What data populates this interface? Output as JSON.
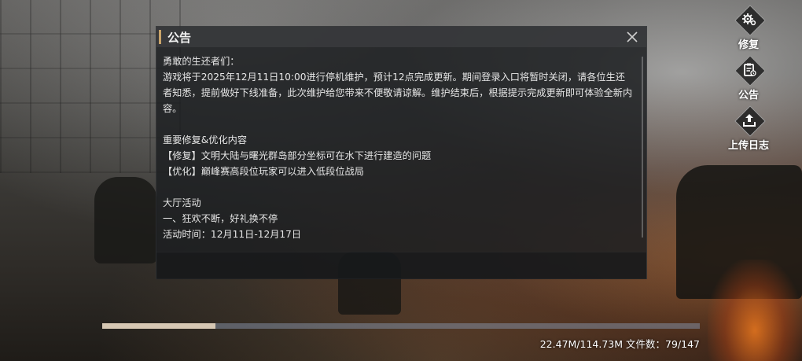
{
  "announcement": {
    "title": "公告",
    "paragraphs": [
      "勇敢的生还者们：",
      "游戏将于2025年12月11日10:00进行停机维护，预计12点完成更新。期间登录入口将暂时关闭，请各位生还者知悉，提前做好下线准备，此次维护给您带来不便敬请谅解。维护结束后，根据提示完成更新即可体验全新内容。",
      "",
      "重要修复&优化内容",
      "【修复】文明大陆与曙光群岛部分坐标可在水下进行建造的问题",
      "【优化】巅峰赛高段位玩家可以进入低段位战局",
      "",
      "大厅活动",
      "一、狂欢不断，好礼换不停",
      "活动时间：12月11日-12月17日"
    ]
  },
  "side_buttons": [
    {
      "label": "修复",
      "icon": "gear-repair-icon"
    },
    {
      "label": "公告",
      "icon": "notice-icon"
    },
    {
      "label": "上传日志",
      "icon": "upload-icon"
    }
  ],
  "download": {
    "progress_fraction": 0.189,
    "status_text": "22.47M/114.73M 文件数：79/147"
  },
  "colors": {
    "accent": "#c9a46a",
    "progress_fill": "#d6c7b3",
    "progress_track": "#8a93a4"
  }
}
